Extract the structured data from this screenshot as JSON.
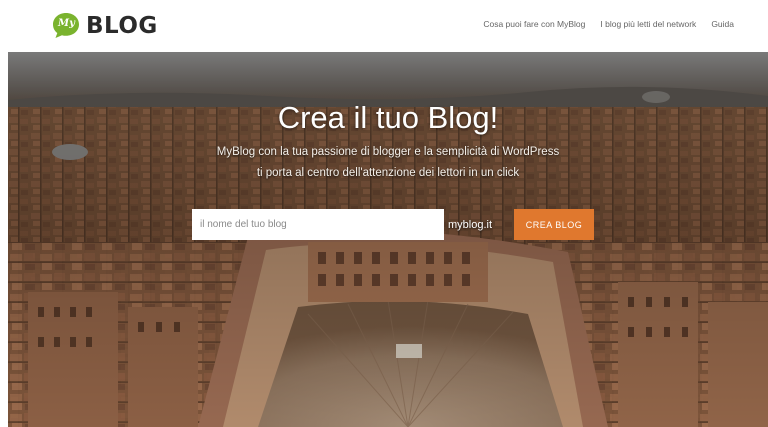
{
  "brand": {
    "logo_text": "BLOG",
    "logo_badge_text": "My",
    "accent_color": "#7ab32e"
  },
  "nav": {
    "items": [
      {
        "label": "Cosa puoi fare con MyBlog"
      },
      {
        "label": "I blog più letti del network"
      },
      {
        "label": "Guida"
      }
    ]
  },
  "hero": {
    "title": "Crea il tuo Blog!",
    "subtitle_line1": "MyBlog con la tua passione di blogger e la semplicità di WordPress",
    "subtitle_line2": "ti porta al centro dell'attenzione dei lettori in un click",
    "input_placeholder": "il nome del tuo blog",
    "domain_suffix": "myblog.it",
    "cta_label": "CREA BLOG",
    "cta_color": "#e0782e"
  }
}
